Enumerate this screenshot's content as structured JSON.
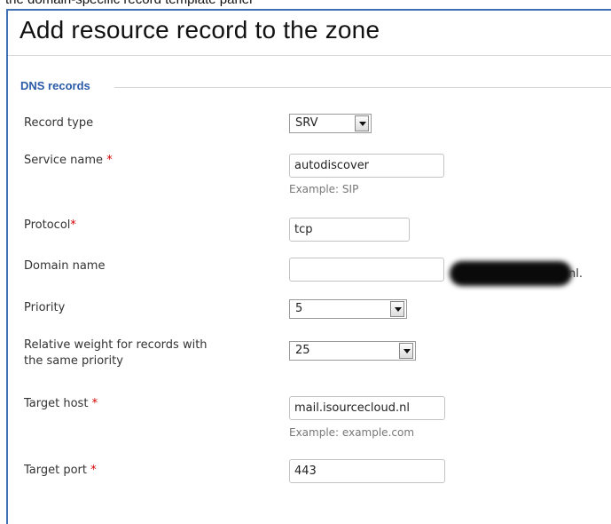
{
  "top_strip_text": "the domain-specific record template panel",
  "title": "Add resource record to the zone",
  "section_legend": "DNS records",
  "fields": {
    "record_type": {
      "label": "Record type",
      "value": "SRV"
    },
    "service_name": {
      "label": "Service name",
      "required_mark": "*",
      "value": "autodiscover",
      "hint": "Example: SIP"
    },
    "protocol": {
      "label": "Protocol",
      "required_mark": "*",
      "value": "tcp"
    },
    "domain_name": {
      "label": "Domain name",
      "value": "",
      "suffix": "nl."
    },
    "priority": {
      "label": "Priority",
      "value": "5"
    },
    "weight": {
      "label_line1": "Relative weight for records with",
      "label_line2": "the same priority",
      "value": "25"
    },
    "target_host": {
      "label": "Target host",
      "required_mark": "*",
      "value": "mail.isourcecloud.nl",
      "hint": "Example: example.com"
    },
    "target_port": {
      "label": "Target port",
      "required_mark": "*",
      "value": "443"
    }
  },
  "colors": {
    "accent": "#3f6fb5",
    "legend": "#2a5aa8",
    "required": "#d40000"
  }
}
